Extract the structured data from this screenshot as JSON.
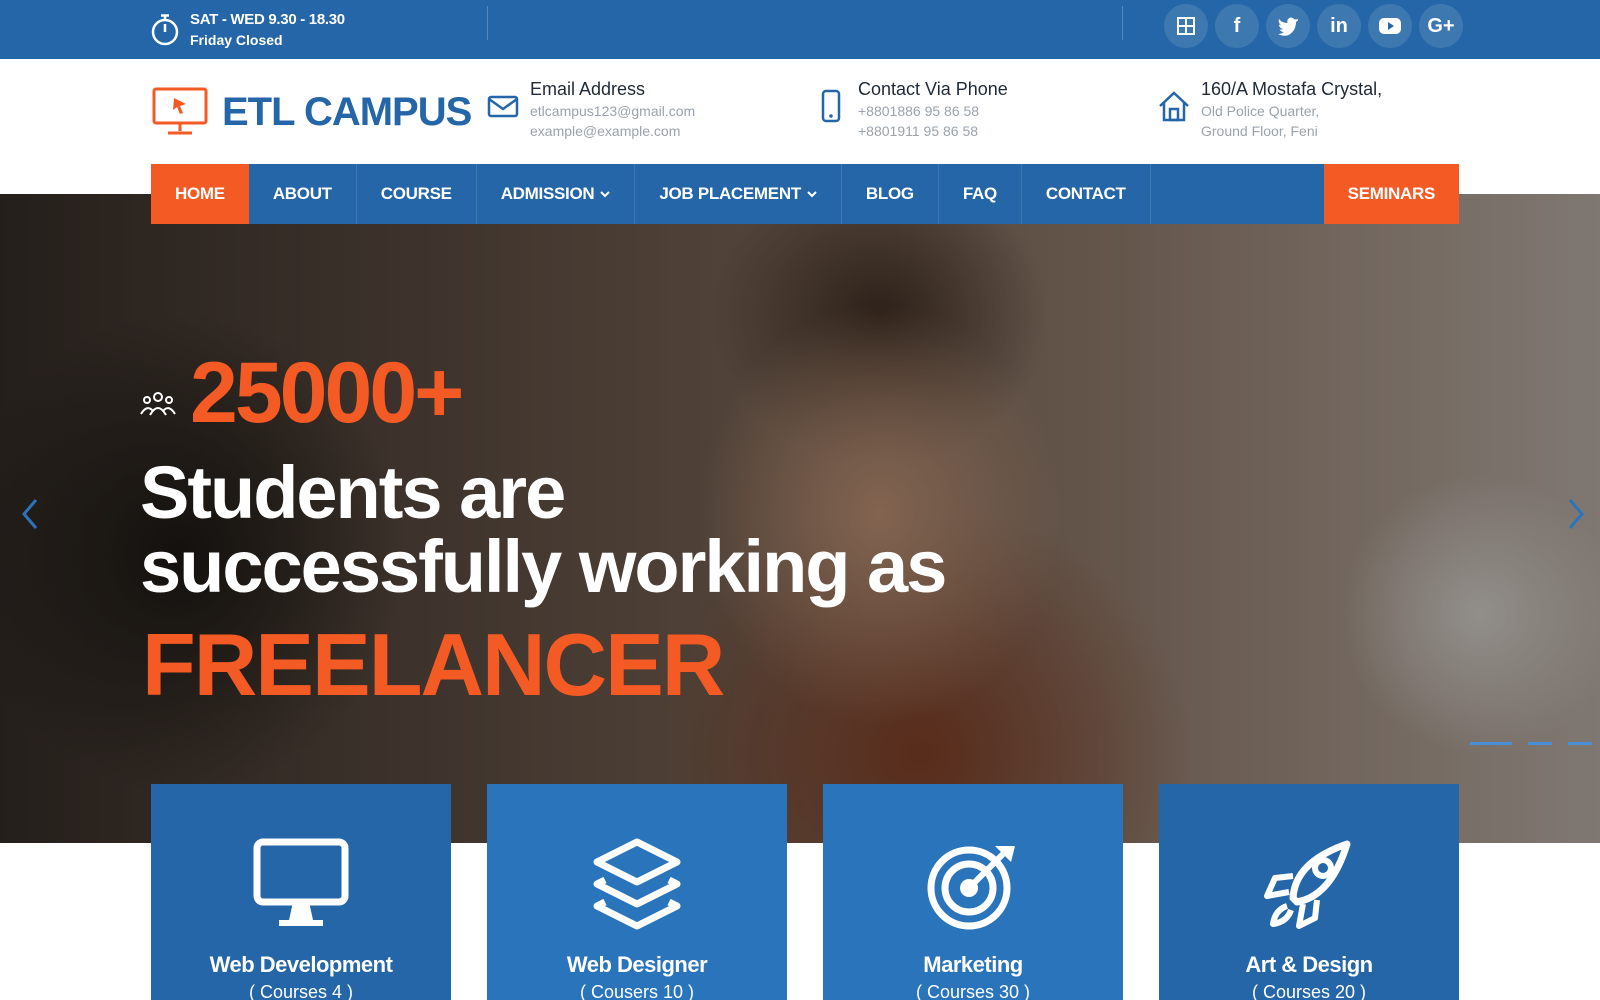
{
  "topbar": {
    "hours_line1": "SAT - WED 9.30 - 18.30",
    "hours_line2": "Friday Closed",
    "social_icons": [
      "grid-icon",
      "facebook-icon",
      "twitter-icon",
      "linkedin-icon",
      "youtube-icon",
      "google-plus-icon"
    ],
    "social_glyphs": [
      "",
      "f",
      "",
      "in",
      "",
      "G+"
    ]
  },
  "header": {
    "logo_text": "ETL CAMPUS",
    "email": {
      "title": "Email Address",
      "line1": "etlcampus123@gmail.com",
      "line2": "example@example.com"
    },
    "phone": {
      "title": "Contact Via Phone",
      "line1": "+8801886 95 86 58",
      "line2": "+8801911 95 86 58"
    },
    "address": {
      "title": "160/A Mostafa Crystal,",
      "line1": "Old Police Quarter,",
      "line2": "Ground Floor, Feni"
    }
  },
  "nav": {
    "items": [
      "HOME",
      "ABOUT",
      "COURSE",
      "ADMISSION",
      "JOB PLACEMENT",
      "BLOG",
      "FAQ",
      "CONTACT"
    ],
    "seminars": "SEMINARS",
    "active": "HOME"
  },
  "hero": {
    "count": "25000+",
    "headline_line1": "Students are",
    "headline_line2": "successfully working as",
    "accent": "FREELANCER",
    "slide_count": 3,
    "active_slide": 1
  },
  "cards": [
    {
      "title": "Web Development",
      "sub": "( Courses 4 )",
      "icon": "monitor-icon"
    },
    {
      "title": "Web Designer",
      "sub": "( Cousers 10 )",
      "icon": "layers-icon"
    },
    {
      "title": "Marketing",
      "sub": "( Courses 30 )",
      "icon": "target-icon"
    },
    {
      "title": "Art & Design",
      "sub": "( Courses 20 )",
      "icon": "rocket-icon"
    }
  ],
  "colors": {
    "brand_blue": "#2466a7",
    "accent_orange": "#f45a24"
  }
}
